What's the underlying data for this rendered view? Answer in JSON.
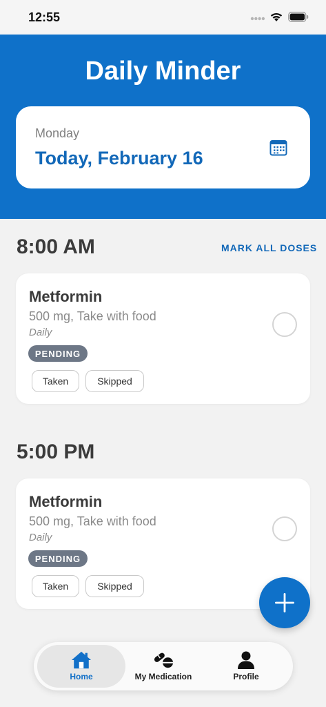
{
  "status_bar": {
    "time": "12:55"
  },
  "header": {
    "title": "Daily Minder",
    "date_card": {
      "weekday": "Monday",
      "date": "Today, February 16"
    }
  },
  "schedule": {
    "mark_all_label": "MARK ALL DOSES",
    "slots": [
      {
        "time": "8:00 AM",
        "medication": {
          "name": "Metformin",
          "dose": "500 mg, Take with food",
          "frequency": "Daily",
          "status": "PENDING",
          "taken_label": "Taken",
          "skipped_label": "Skipped"
        }
      },
      {
        "time": "5:00 PM",
        "medication": {
          "name": "Metformin",
          "dose": "500 mg, Take with food",
          "frequency": "Daily",
          "status": "PENDING",
          "taken_label": "Taken",
          "skipped_label": "Skipped"
        }
      }
    ]
  },
  "fab": {
    "icon": "plus-icon"
  },
  "bottom_nav": {
    "items": [
      {
        "label": "Home",
        "icon": "home-icon",
        "active": true
      },
      {
        "label": "My Medication",
        "icon": "pills-icon",
        "active": false
      },
      {
        "label": "Profile",
        "icon": "person-icon",
        "active": false
      }
    ]
  },
  "colors": {
    "primary": "#0f71c9",
    "date_text": "#1268b8",
    "pending_badge": "#6d7786",
    "background": "#f2f2f2"
  }
}
